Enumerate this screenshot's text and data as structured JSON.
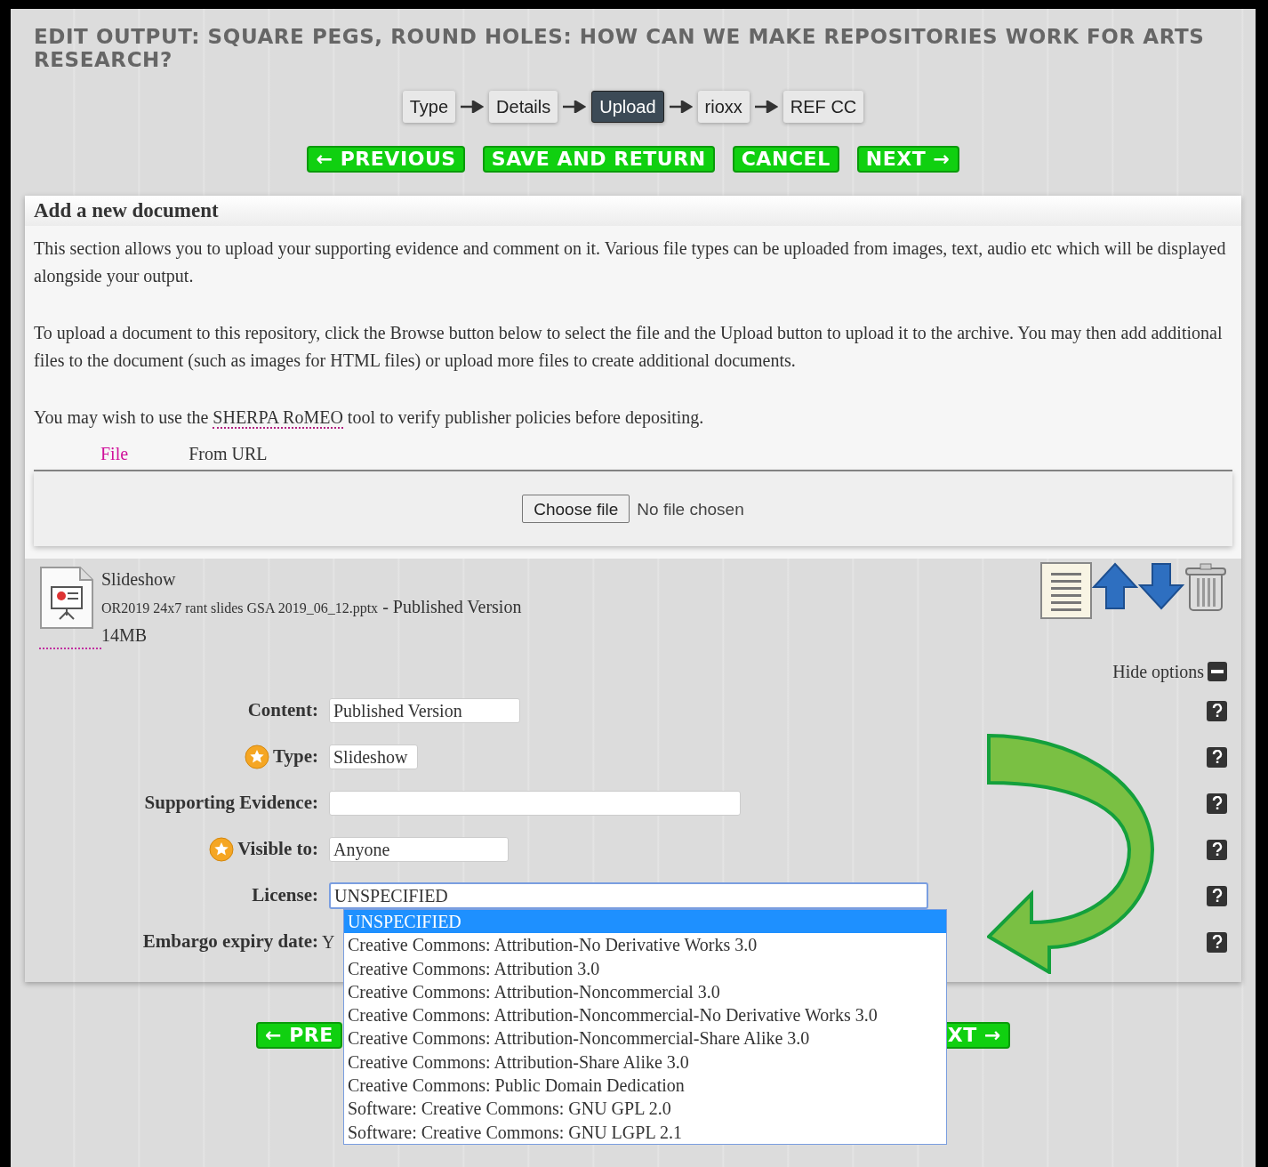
{
  "title": "EDIT OUTPUT: SQUARE PEGS, ROUND HOLES: HOW CAN WE MAKE REPOSITORIES WORK FOR ARTS RESEARCH?",
  "steps": [
    {
      "label": "Type",
      "selected": false
    },
    {
      "label": "Details",
      "selected": false
    },
    {
      "label": "Upload",
      "selected": true
    },
    {
      "label": "rioxx",
      "selected": false
    },
    {
      "label": "REF CC",
      "selected": false
    }
  ],
  "buttons": [
    "← PREVIOUS",
    "SAVE AND RETURN",
    "CANCEL",
    "NEXT →"
  ],
  "panel": {
    "heading": "Add a new document",
    "paragraphs": [
      "This section allows you to upload your supporting evidence and comment on it. Various file types can be uploaded from images, text, audio etc which will be displayed alongside your output.",
      "To upload a document to this repository, click the Browse button below to select the file and the Upload button to upload it to the archive. You may then add additional files to the document (such as images for HTML files) or upload more files to create additional documents."
    ],
    "sherpa": {
      "before": "You may wish to use the",
      "link": "SHERPA RoMEO",
      "after": "tool to verify publisher policies before depositing."
    },
    "upload_tabs": [
      {
        "label": "File",
        "selected": true
      },
      {
        "label": "From URL",
        "selected": false
      }
    ],
    "file_button": "Choose file",
    "file_status": "No file chosen"
  },
  "document": {
    "type": "Slideshow",
    "filename": "OR2019 24x7 rant slides GSA 2019_06_12.pptx",
    "version": "- Published Version",
    "size": "14MB",
    "hide_options": "Hide options"
  },
  "form": [
    {
      "label": "Content:",
      "kind": "field",
      "required": false,
      "value": "Published Version"
    },
    {
      "label": "Type:",
      "kind": "field",
      "required": true,
      "value": "Slideshow"
    },
    {
      "label": "Supporting Evidence:",
      "kind": "field",
      "required": false
    },
    {
      "label": "Visible to:",
      "kind": "field",
      "required": true,
      "value": "Anyone"
    },
    {
      "label": "License:",
      "kind": "select",
      "required": false,
      "value": "UNSPECIFIED"
    },
    {
      "label": "Embargo expiry date:",
      "kind": "text",
      "required": false,
      "value": "Y"
    }
  ],
  "license_options": [
    {
      "label": "UNSPECIFIED",
      "selected": true
    },
    {
      "label": "Creative Commons: Attribution-No Derivative Works 3.0",
      "selected": false
    },
    {
      "label": "Creative Commons: Attribution 3.0",
      "selected": false
    },
    {
      "label": "Creative Commons: Attribution-Noncommercial 3.0",
      "selected": false
    },
    {
      "label": "Creative Commons: Attribution-Noncommercial-No Derivative Works 3.0",
      "selected": false
    },
    {
      "label": "Creative Commons: Attribution-Noncommercial-Share Alike 3.0",
      "selected": false
    },
    {
      "label": "Creative Commons: Attribution-Share Alike 3.0",
      "selected": false
    },
    {
      "label": "Creative Commons: Public Domain Dedication",
      "selected": false
    },
    {
      "label": "Software: Creative Commons: GNU GPL 2.0",
      "selected": false
    },
    {
      "label": "Software: Creative Commons: GNU LGPL 2.1",
      "selected": false
    }
  ],
  "bottom_buttons": [
    "← PRE",
    "XT →"
  ]
}
